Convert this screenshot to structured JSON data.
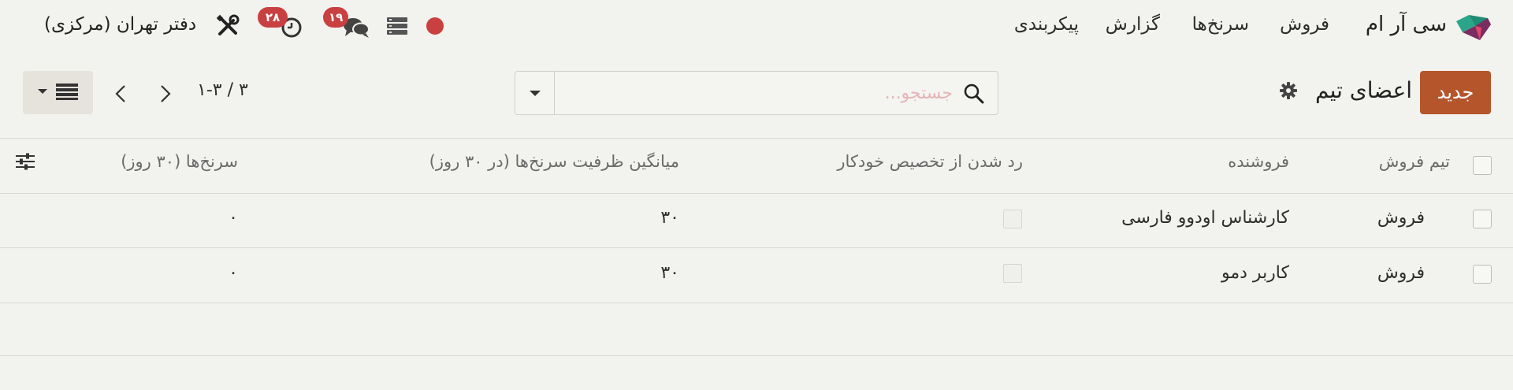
{
  "navbar": {
    "app_title": "سی آر ام",
    "menu": [
      "فروش",
      "سرنخ‌ها",
      "گزارش",
      "پیکربندی"
    ],
    "messages_count": "۱۹",
    "activities_count": "۲۸",
    "company": "دفتر تهران (مرکزی)"
  },
  "control_panel": {
    "new_button": "جدید",
    "title": "اعضای تیم",
    "search_placeholder": "جستجو...",
    "pager": "۱-۳ / ۳"
  },
  "table": {
    "columns": [
      "تیم فروش",
      "فروشنده",
      "رد شدن از تخصیص خودکار",
      "میانگین ظرفیت سرنخ‌ها (در ۳۰ روز)",
      "سرنخ‌ها (۳۰ روز)"
    ],
    "rows": [
      {
        "team": "فروش",
        "salesperson": "کارشناس اودوو فارسی",
        "skip_auto_assign": false,
        "avg_capacity": "۳۰",
        "leads": "۰"
      },
      {
        "team": "فروش",
        "salesperson": "کاربر دمو",
        "skip_auto_assign": false,
        "avg_capacity": "۳۰",
        "leads": "۰"
      }
    ]
  },
  "colors": {
    "background": "#f2f2ee",
    "primary_button": "#b5552b",
    "badge": "#c94040",
    "logo_green": "#2aa58a",
    "logo_purple": "#7b2d61"
  }
}
